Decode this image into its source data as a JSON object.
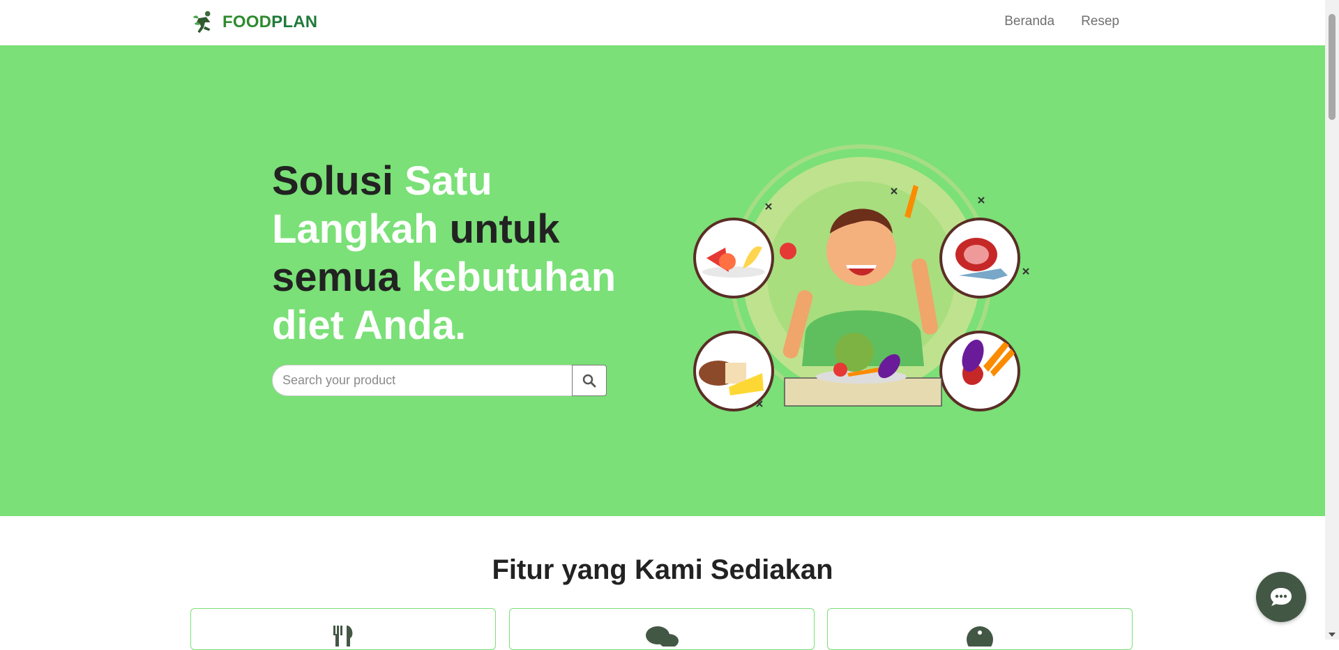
{
  "brand": {
    "part1": "FOOD",
    "part2": "PLAN"
  },
  "nav": {
    "items": [
      {
        "label": "Beranda"
      },
      {
        "label": "Resep"
      }
    ]
  },
  "hero": {
    "headline": {
      "w1": "Solusi ",
      "w2": "Satu",
      "w3": "Langkah",
      "w4": " untuk",
      "w5": "semua ",
      "w6": "kebutuhan",
      "w7": "diet Anda."
    },
    "search": {
      "placeholder": "Search your product",
      "value": ""
    }
  },
  "features": {
    "title": "Fitur yang Kami Sediakan",
    "cards": [
      {
        "icon": "utensils-icon"
      },
      {
        "icon": "chat-bubbles-icon"
      },
      {
        "icon": "info-icon"
      }
    ]
  },
  "colors": {
    "hero_bg": "#7ae077",
    "brand_green": "#2e8b2e",
    "chat_bg": "#435745"
  }
}
